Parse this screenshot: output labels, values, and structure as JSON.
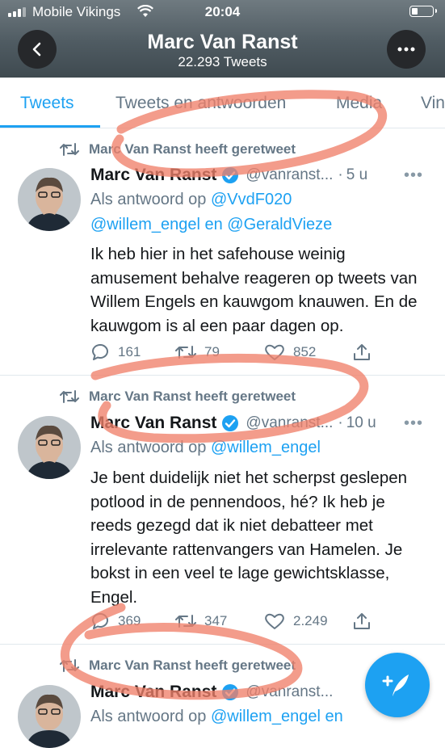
{
  "status_bar": {
    "carrier": "Mobile Vikings",
    "time": "20:04"
  },
  "header": {
    "name": "Marc Van Ranst",
    "tweet_count": "22.293 Tweets"
  },
  "tabs": [
    "Tweets",
    "Tweets en antwoorden",
    "Media",
    "Vin"
  ],
  "tweets": [
    {
      "retweeted_by": "Marc Van Ranst heeft geretweet",
      "name": "Marc Van Ranst",
      "handle": "@vanranst...",
      "time": "5 u",
      "reply_prefix": "Als antwoord op",
      "reply_mention_1": "@VvdF020",
      "reply_mention_2": "@willem_engel",
      "reply_joiner": "en",
      "reply_mention_3": "@GeraldVieze",
      "text": "Ik heb hier in het safehouse weinig amusement behalve reageren op tweets van Willem Engels en kauwgom knauwen. En de kauwgom is al een paar dagen op.",
      "replies": "161",
      "retweets": "79",
      "likes": "852"
    },
    {
      "retweeted_by": "Marc Van Ranst heeft geretweet",
      "name": "Marc Van Ranst",
      "handle": "@vanranst...",
      "time": "10 u",
      "reply_prefix": "Als antwoord op",
      "reply_mention_1": "@willem_engel",
      "text": "Je bent duidelijk niet het scherpst geslepen potlood in de pennendoos, hé? Ik heb je reeds gezegd dat ik niet debatteer met irrelevante rattenvangers van Hamelen. Je bokst in een veel te lage gewichtsklasse, Engel.",
      "replies": "369",
      "retweets": "347",
      "likes": "2.249"
    },
    {
      "retweeted_by": "Marc Van Ranst heeft geretweet",
      "name": "Marc Van Ranst",
      "handle": "@vanranst...",
      "reply_prefix": "Als antwoord op",
      "reply_mention_1": "@willem_engel",
      "reply_joiner": "en"
    }
  ],
  "colors": {
    "accent": "#1da1f2",
    "annotation": "#f0806a"
  },
  "icons": [
    "back-icon",
    "more-icon",
    "retweet-icon",
    "verified-icon",
    "reply-icon",
    "like-icon",
    "share-icon",
    "compose-icon"
  ]
}
